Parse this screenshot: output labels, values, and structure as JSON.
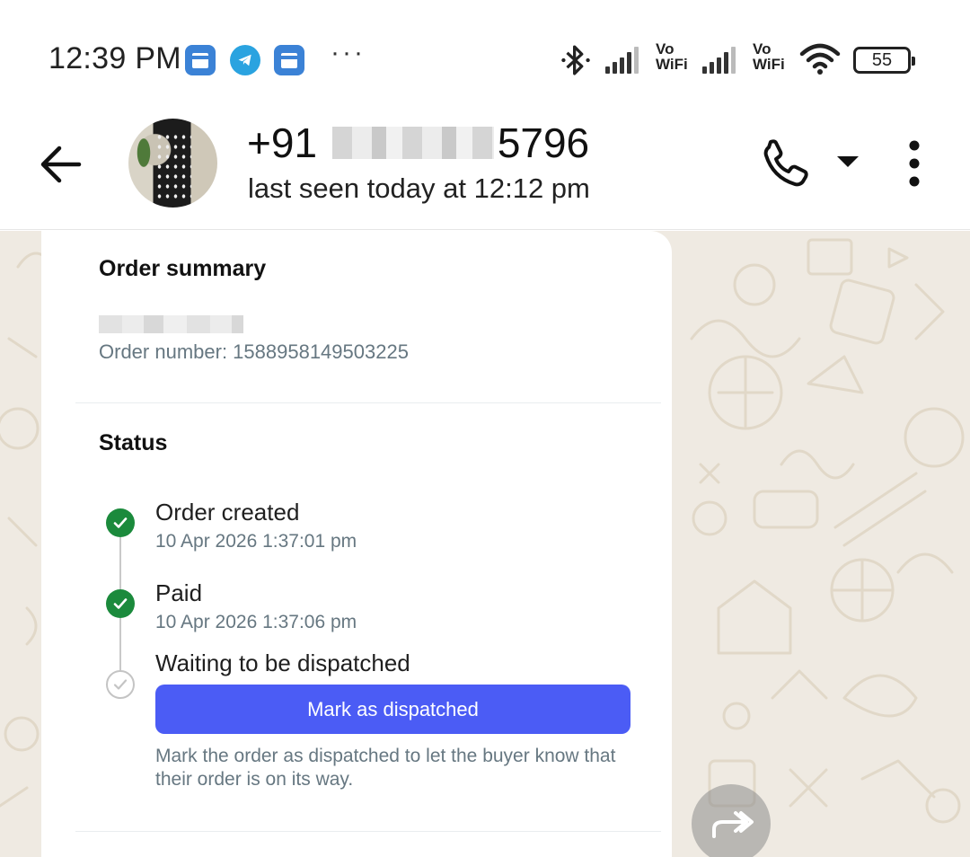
{
  "status_bar": {
    "time": "12:39 PM",
    "more": "···",
    "vowifi_1": "Vo\nWiFi",
    "vowifi_2": "Vo\nWiFi",
    "battery": "55"
  },
  "header": {
    "contact_prefix": "+91",
    "contact_suffix": "5796",
    "last_seen": "last seen today at 12:12 pm"
  },
  "order_card": {
    "title": "Order summary",
    "order_number": "Order number: 1588958149503225",
    "status_title": "Status",
    "steps": [
      {
        "label": "Order created",
        "time": "10 Apr 2026 1:37:01 pm",
        "state": "done"
      },
      {
        "label": "Paid",
        "time": "10 Apr 2026 1:37:06 pm",
        "state": "done"
      },
      {
        "label": "Waiting to be dispatched",
        "time": "",
        "state": "pending"
      }
    ],
    "dispatch_button": "Mark as dispatched",
    "help_text": "Mark the order as dispatched to let the buyer know that their order is on its way."
  },
  "colors": {
    "accent_button": "#4b5cf5",
    "done_green": "#1b8a3c",
    "chat_background": "#efeae2"
  }
}
